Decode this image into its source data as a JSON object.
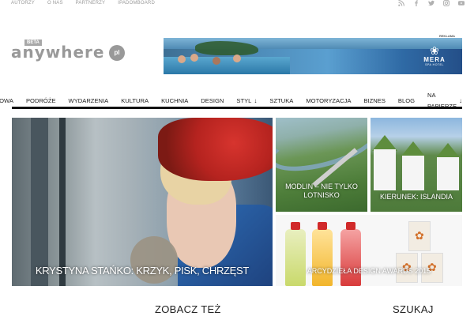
{
  "topbar": {
    "links": [
      "AUTORZY",
      "O NAS",
      "PARTNERZY",
      "IPADOMBOARD"
    ],
    "social_icons": [
      "rss-icon",
      "facebook-icon",
      "twitter-icon",
      "instagram-icon",
      "youtube-icon"
    ]
  },
  "logo": {
    "beta": "BETA",
    "word": "anywhere",
    "pl": "pl"
  },
  "ad": {
    "label": "REKLAMA",
    "brand": "MERA",
    "brand_sub": "SPA HOTEL"
  },
  "nav": {
    "items": [
      {
        "label": "ROZMOWA",
        "dropdown": false
      },
      {
        "label": "PODRÓŻE",
        "dropdown": false
      },
      {
        "label": "WYDARZENIA",
        "dropdown": false
      },
      {
        "label": "KULTURA",
        "dropdown": false
      },
      {
        "label": "KUCHNIA",
        "dropdown": false
      },
      {
        "label": "DESIGN",
        "dropdown": false
      },
      {
        "label": "STYL",
        "dropdown": true
      },
      {
        "label": "SZTUKA",
        "dropdown": false
      },
      {
        "label": "MOTORYZACJA",
        "dropdown": false
      },
      {
        "label": "BIZNES",
        "dropdown": false
      },
      {
        "label": "BLOG",
        "dropdown": false
      },
      {
        "label": "NA PAPIERZE",
        "dropdown": true
      }
    ],
    "dropdown_arrow": "↓"
  },
  "tiles": {
    "hero": "KRYSTYNA STAŃKO: KRZYK, PISK, CHRZĘST",
    "modlin": "MODLIN – NIE TYLKO LOTNISKO",
    "islandia": "KIERUNEK: ISLANDIA",
    "design": "ARCYDZIEŁA DESIGN AWARDS 2015"
  },
  "headings": {
    "see_also": "ZOBACZ TEŻ",
    "search": "SZUKAJ"
  },
  "colors": {
    "nav_rule": "#111111",
    "hero_scarf": "#b5231f",
    "ad_blue": "#4d8bb8"
  }
}
